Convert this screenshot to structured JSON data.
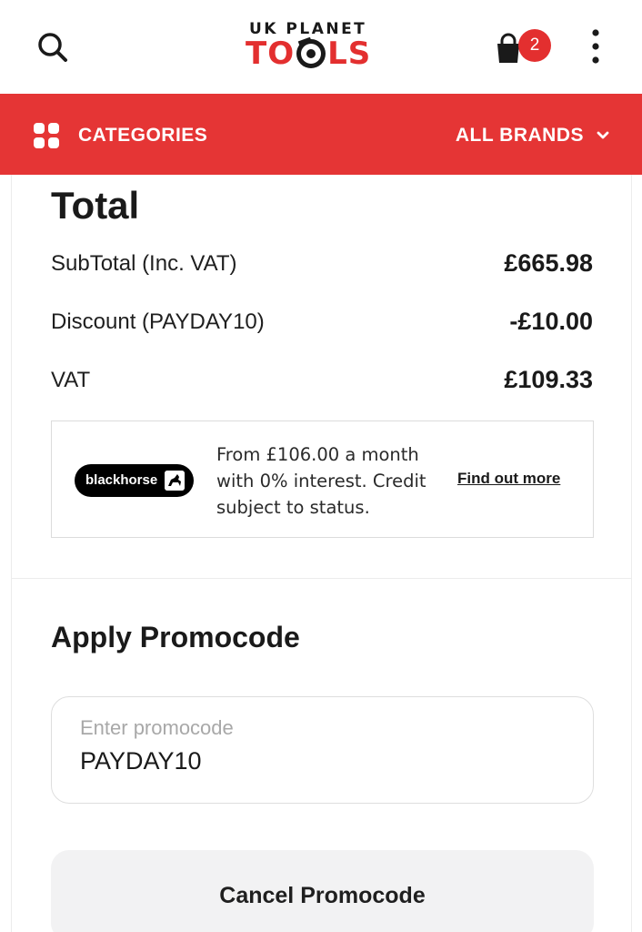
{
  "header": {
    "logo_top": "UK PLANET",
    "logo_main_left": "TO",
    "logo_main_right": "LS",
    "cart_count": "2",
    "icons": {
      "search": "search-icon",
      "cart": "shopping-bag-icon",
      "more": "more-vertical-icon"
    }
  },
  "nav": {
    "categories_label": "CATEGORIES",
    "brands_label": "ALL BRANDS"
  },
  "totals": {
    "title": "Total",
    "rows": [
      {
        "label": "SubTotal (Inc. VAT)",
        "value": "£665.98"
      },
      {
        "label": "Discount (PAYDAY10)",
        "value": "-£10.00"
      },
      {
        "label": "VAT",
        "value": "£109.33"
      }
    ]
  },
  "finance": {
    "provider": "blackhorse",
    "text": "From £106.00 a month with 0% interest. Credit subject to status.",
    "link": "Find out more"
  },
  "promo": {
    "title": "Apply Promocode",
    "placeholder": "Enter promocode",
    "value": "PAYDAY10",
    "cancel_label": "Cancel Promocode"
  },
  "colors": {
    "brand_red": "#e53535",
    "badge_red": "#e32f2f",
    "text_dark": "#1a1a1a",
    "muted": "#a8a8a8"
  }
}
